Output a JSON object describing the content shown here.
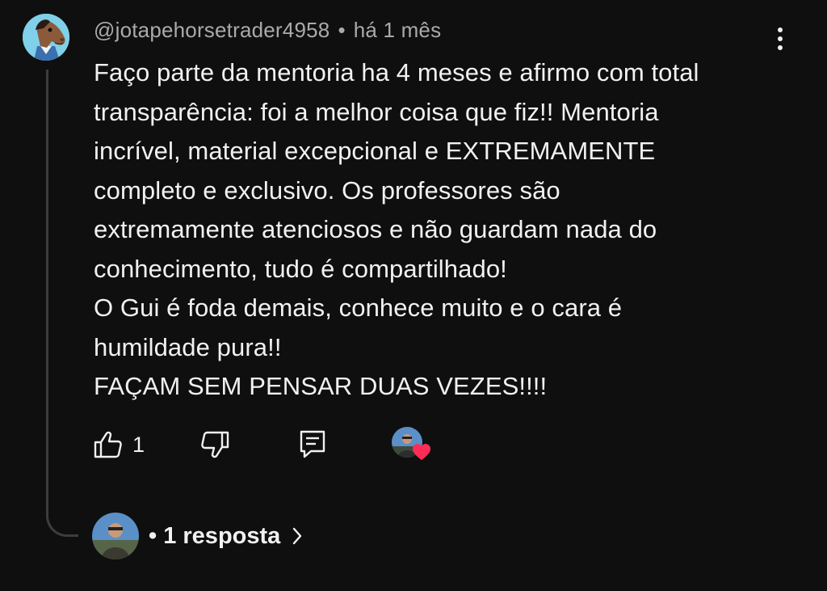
{
  "comment": {
    "author_handle": "@jotapehorsetrader4958",
    "separator": "•",
    "time_ago": "há 1 mês",
    "text_lines": [
      "Faço parte da mentoria ha 4 meses e afirmo com total",
      "transparência: foi a melhor coisa que fiz!! Mentoria",
      "incrível, material excepcional e EXTREMAMENTE",
      "completo e exclusivo. Os professores são",
      "extremamente atenciosos e não guardam nada do",
      "conhecimento, tudo é compartilhado!",
      "O Gui é foda demais, conhece muito e o cara é",
      "humildade pura!!",
      "FAÇAM SEM PENSAR DUAS VEZES!!!!"
    ]
  },
  "actions": {
    "like_count": "1",
    "icons": [
      "thumbs-up-icon",
      "thumbs-down-icon",
      "reply-icon",
      "creator-heart-icon"
    ]
  },
  "replies": {
    "label": "• 1 resposta"
  },
  "colors": {
    "background": "#0f0f0f",
    "text": "#f1f1f1",
    "secondary_text": "#aaaaaa",
    "heart": "#ff2d55",
    "thread_line": "#3d3d3d"
  }
}
